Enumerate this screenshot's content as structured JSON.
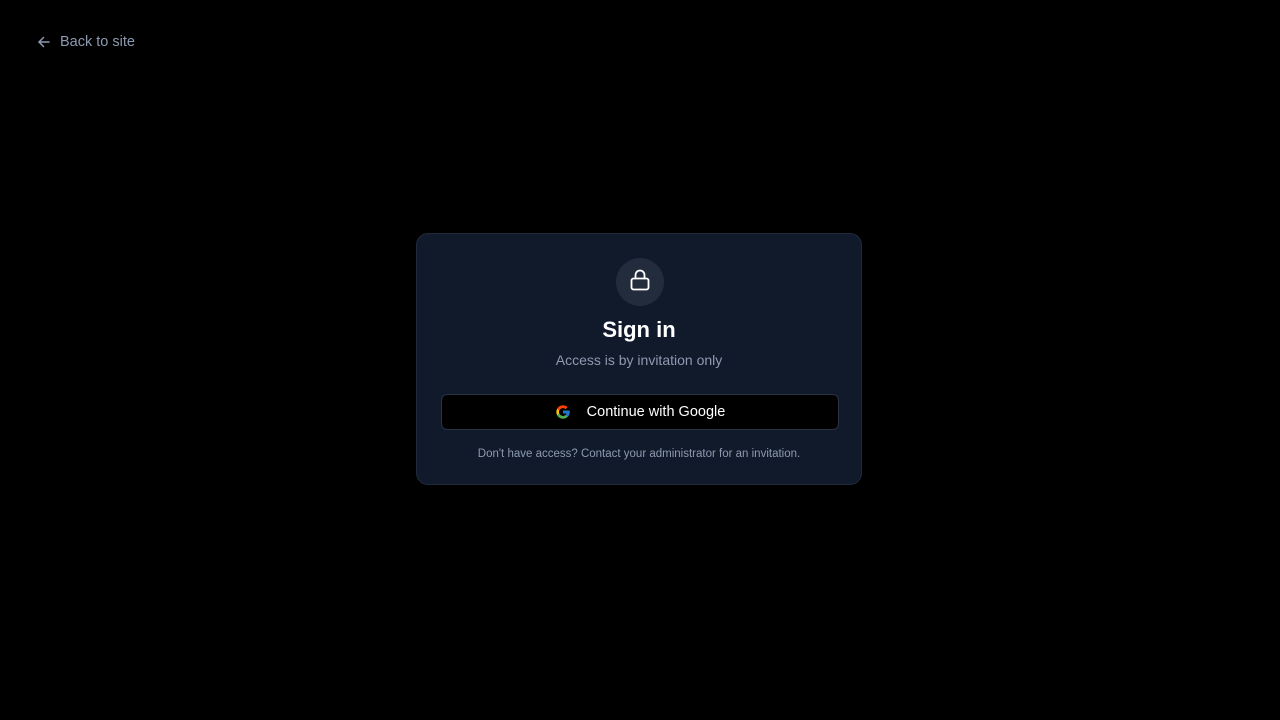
{
  "nav": {
    "back_label": "Back to site",
    "back_icon": "arrow-left-icon"
  },
  "card": {
    "icon": "lock-icon",
    "title": "Sign in",
    "subtitle": "Access is by invitation only",
    "google_button_label": "Continue with Google",
    "google_icon": "google-icon",
    "footnote": "Don't have access? Contact your administrator for an invitation."
  },
  "colors": {
    "background": "#000000",
    "card_background": "#111a2b",
    "card_border": "#1f2a3c",
    "muted_text": "#8d9ab0",
    "primary_text": "#ffffff"
  }
}
